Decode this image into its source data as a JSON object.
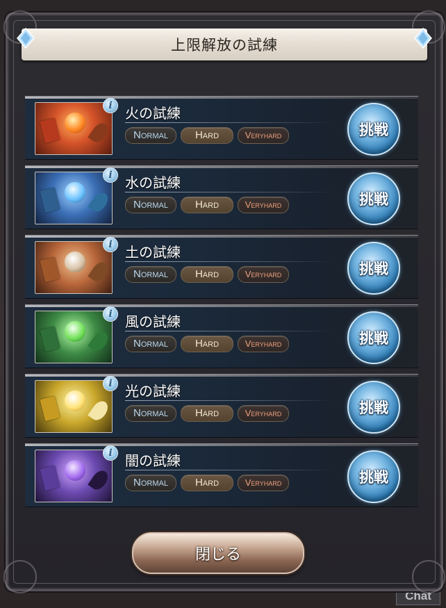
{
  "dialog": {
    "title": "上限解放の試練",
    "close_label": "閉じる"
  },
  "trials": [
    {
      "name": "火の試練",
      "normal": "Normal",
      "hard": "Hard",
      "veryhard": "Veryhard",
      "challenge": "挑戦",
      "info": "i",
      "color": "#d6542a"
    },
    {
      "name": "水の試練",
      "normal": "Normal",
      "hard": "Hard",
      "veryhard": "Veryhard",
      "challenge": "挑戦",
      "info": "i",
      "color": "#3b6fb6"
    },
    {
      "name": "土の試練",
      "normal": "Normal",
      "hard": "Hard",
      "veryhard": "Veryhard",
      "challenge": "挑戦",
      "info": "i",
      "color": "#b8663a"
    },
    {
      "name": "風の試練",
      "normal": "Normal",
      "hard": "Hard",
      "veryhard": "Veryhard",
      "challenge": "挑戦",
      "info": "i",
      "color": "#3d8a45"
    },
    {
      "name": "光の試練",
      "normal": "Normal",
      "hard": "Hard",
      "veryhard": "Veryhard",
      "challenge": "挑戦",
      "info": "i",
      "color": "#c9a72b"
    },
    {
      "name": "闇の試練",
      "normal": "Normal",
      "hard": "Hard",
      "veryhard": "Veryhard",
      "challenge": "挑戦",
      "info": "i",
      "color": "#6b4ab0"
    }
  ],
  "chat": {
    "label": "Chat"
  }
}
